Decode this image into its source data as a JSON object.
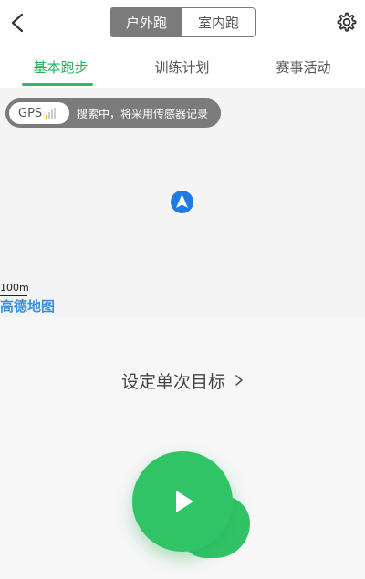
{
  "header": {
    "segment_tabs": [
      {
        "label": "户外跑",
        "active": true
      },
      {
        "label": "室内跑",
        "active": false
      }
    ],
    "icons": {
      "back": "chevron-left-icon",
      "settings": "gear-icon"
    }
  },
  "tabs": [
    {
      "label": "基本跑步",
      "active": true
    },
    {
      "label": "训练计划",
      "active": false
    },
    {
      "label": "赛事活动",
      "active": false
    }
  ],
  "map": {
    "gps_label": "GPS",
    "gps_signal_bars": 1,
    "gps_message": "搜索中，将采用传感器记录",
    "scale": "100m",
    "provider_logo": "高德地图"
  },
  "main": {
    "goal_label": "设定单次目标"
  },
  "colors": {
    "accent_green": "#31c467",
    "segment_active_bg": "#7b7b7b",
    "map_logo_blue": "#3a8fd9",
    "location_blue": "#1e7be6"
  }
}
